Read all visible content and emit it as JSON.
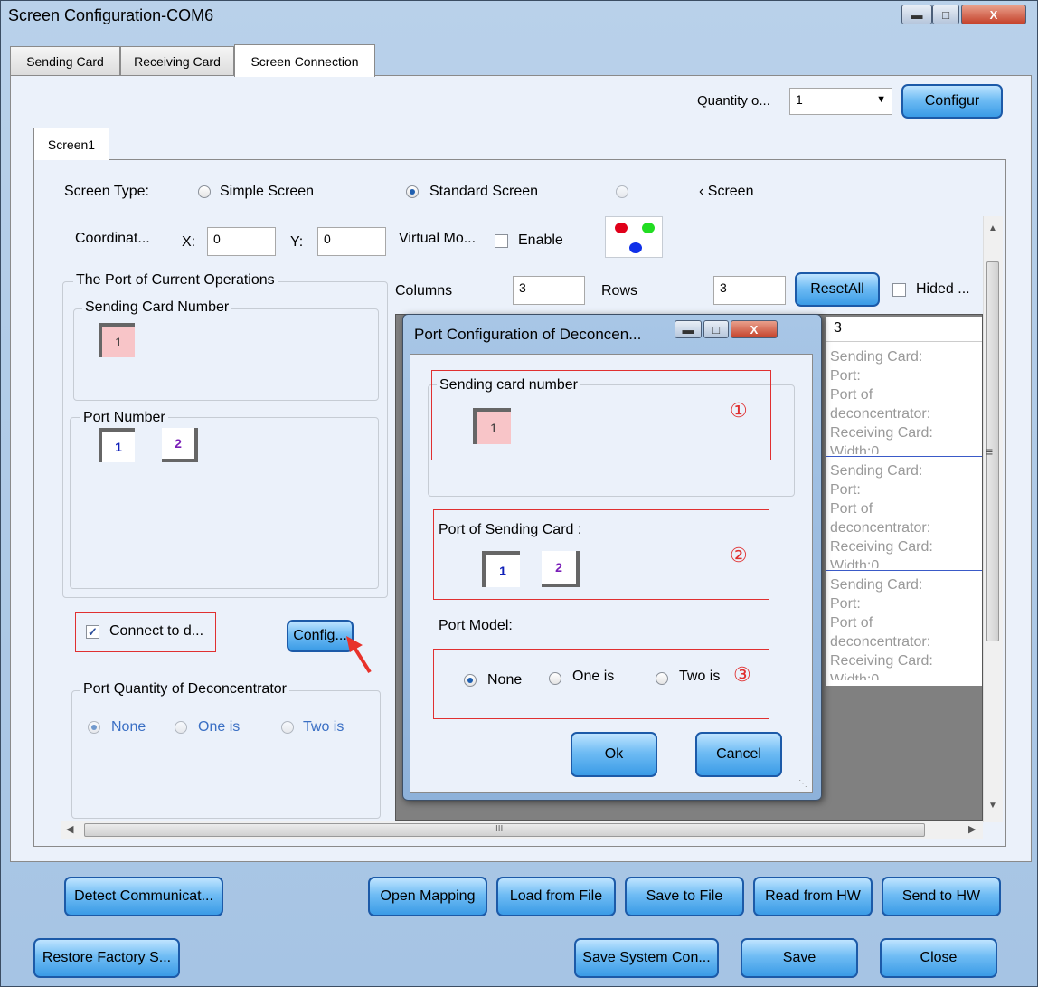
{
  "window": {
    "title": "Screen Configuration-COM6"
  },
  "tabs": [
    {
      "label": "Sending Card"
    },
    {
      "label": "Receiving Card"
    },
    {
      "label": "Screen Connection"
    }
  ],
  "quantity": {
    "label": "Quantity o...",
    "value": "1",
    "configure_button": "Configur"
  },
  "screen_tab": "Screen1",
  "screen_type": {
    "label": "Screen Type:",
    "options": [
      "Simple Screen",
      "Standard Screen",
      "‹ Screen"
    ],
    "selected": "Standard Screen"
  },
  "coordinates": {
    "label": "Coordinat...",
    "x_label": "X:",
    "x_value": "0",
    "y_label": "Y:",
    "y_value": "0"
  },
  "virtual_mode": {
    "label": "Virtual Mo...",
    "enable_label": "Enable",
    "enabled": false
  },
  "current_ops": {
    "title": "The Port of Current Operations",
    "sending_card_title": "Sending Card Number",
    "sending_card_value": "1",
    "port_number_title": "Port Number",
    "ports": [
      "1",
      "2"
    ]
  },
  "grid_controls": {
    "columns_label": "Columns",
    "columns_value": "3",
    "rows_label": "Rows",
    "rows_value": "3",
    "reset_button": "ResetAll",
    "hided_label": "Hided ..."
  },
  "grid": {
    "column_header": "3",
    "cells": [
      [
        "Sending Card:",
        "Port:",
        "Port of",
        "deconcentrator:",
        "Receiving Card:",
        "Width:0"
      ],
      [
        "Sending Card:",
        "Port:",
        "Port of",
        "deconcentrator:",
        "Receiving Card:",
        "Width:0"
      ],
      [
        "Sending Card:",
        "Port:",
        "Port of",
        "deconcentrator:",
        "Receiving Card:",
        "Width:0"
      ]
    ],
    "scroll_mark": "≡",
    "hscroll_mark": "III"
  },
  "connect": {
    "label": "Connect to d...",
    "checked": true,
    "config_button": "Config..."
  },
  "deconcentrator": {
    "title": "Port Quantity of Deconcentrator",
    "options": [
      "None",
      "One is",
      "Two is"
    ],
    "selected": "None"
  },
  "dialog": {
    "title": "Port Configuration of Deconcen...",
    "sending_card_title": "Sending card number",
    "sending_card_value": "1",
    "marker1": "①",
    "port_title": "Port of Sending Card :",
    "ports": [
      "1",
      "2"
    ],
    "marker2": "②",
    "model_title": "Port Model:",
    "model_options": [
      "None",
      "One is",
      "Two is"
    ],
    "model_selected": "None",
    "marker3": "③",
    "ok_button": "Ok",
    "cancel_button": "Cancel"
  },
  "action_buttons": [
    "Detect Communicat...",
    "Open Mapping",
    "Load from File",
    "Save to File",
    "Read from HW",
    "Send to HW"
  ],
  "bottom_buttons": [
    "Restore Factory S...",
    "Save System Con...",
    "Save",
    "Close"
  ],
  "colors": {
    "accent_blue": "#3a9be6",
    "highlight_red": "#e03030",
    "arrow_red": "#e8322a"
  }
}
